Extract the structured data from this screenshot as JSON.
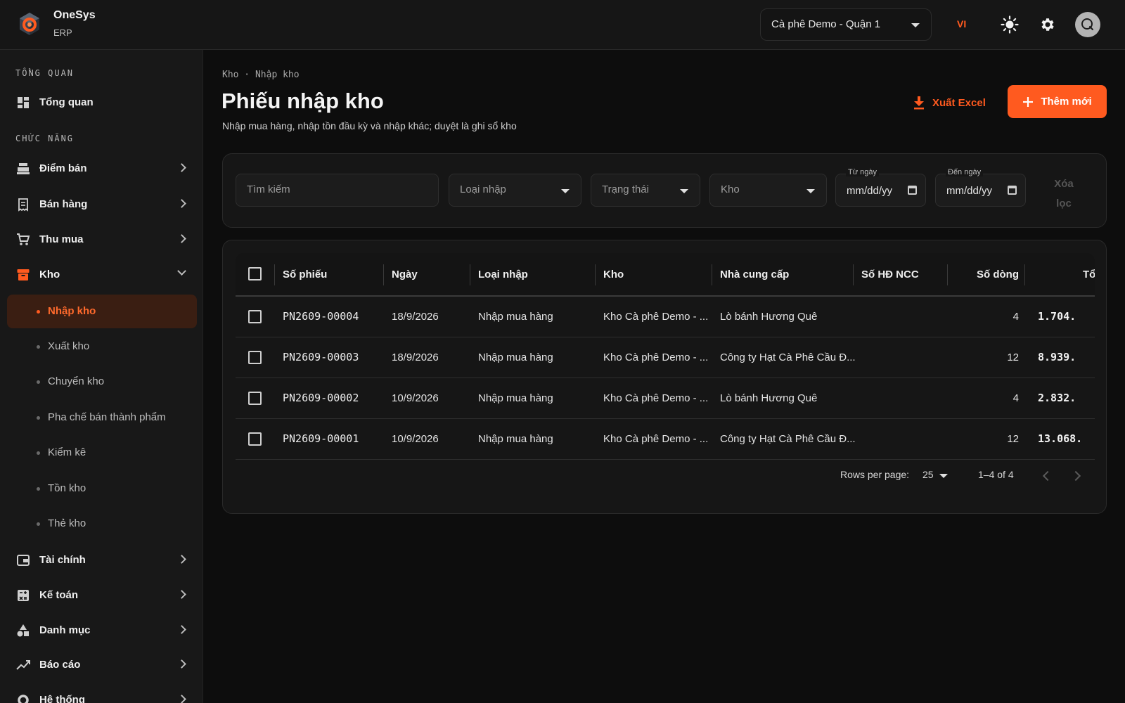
{
  "app": {
    "name": "OneSys",
    "subtitle": "ERP"
  },
  "topbar": {
    "store": "Cà phê Demo - Quận 1",
    "language": "VI"
  },
  "sidebar": {
    "section_overview": "TỔNG QUAN",
    "overview": "Tổng quan",
    "section_functions": "CHỨC NĂNG",
    "items": {
      "pos": "Điểm bán",
      "sales": "Bán hàng",
      "purchasing": "Thu mua",
      "warehouse": "Kho",
      "finance": "Tài chính",
      "accounting": "Kế toán",
      "catalog": "Danh mục",
      "reports": "Báo cáo",
      "system": "Hệ thống"
    },
    "warehouse_sub": {
      "receipt": "Nhập kho",
      "issue": "Xuất kho",
      "transfer": "Chuyển kho",
      "semi_finished": "Pha chế bán thành phẩm",
      "stocktake": "Kiểm kê",
      "inventory": "Tồn kho",
      "stock_card": "Thẻ kho"
    }
  },
  "page": {
    "breadcrumb": "Kho · Nhập kho",
    "title": "Phiếu nhập kho",
    "subtitle": "Nhập mua hàng, nhập tồn đầu kỳ và nhập khác; duyệt là ghi sổ kho",
    "export_label": "Xuất Excel",
    "add_label": "Thêm mới"
  },
  "filters": {
    "search_placeholder": "Tìm kiếm",
    "type_placeholder": "Loại nhập",
    "status_placeholder": "Trạng thái",
    "warehouse_placeholder": "Kho",
    "from_label": "Từ ngày",
    "from_value": "mm/dd/yy",
    "to_label": "Đến ngày",
    "to_value": "mm/dd/yy",
    "clear_label": "Xóa lọc"
  },
  "table": {
    "columns": [
      "Số phiếu",
      "Ngày",
      "Loại nhập",
      "Kho",
      "Nhà cung cấp",
      "Số HĐ NCC",
      "Số dòng",
      "Tổ"
    ],
    "rows": [
      {
        "code": "PN2609-00004",
        "date": "18/9/2026",
        "type": "Nhập mua hàng",
        "warehouse": "Kho Cà phê Demo - ...",
        "supplier": "Lò bánh Hương Quê",
        "invoice": "",
        "lines": "4",
        "total": "1.704."
      },
      {
        "code": "PN2609-00003",
        "date": "18/9/2026",
        "type": "Nhập mua hàng",
        "warehouse": "Kho Cà phê Demo - ...",
        "supplier": "Công ty Hạt Cà Phê Cầu Đ...",
        "invoice": "",
        "lines": "12",
        "total": "8.939."
      },
      {
        "code": "PN2609-00002",
        "date": "10/9/2026",
        "type": "Nhập mua hàng",
        "warehouse": "Kho Cà phê Demo - ...",
        "supplier": "Lò bánh Hương Quê",
        "invoice": "",
        "lines": "4",
        "total": "2.832."
      },
      {
        "code": "PN2609-00001",
        "date": "10/9/2026",
        "type": "Nhập mua hàng",
        "warehouse": "Kho Cà phê Demo - ...",
        "supplier": "Công ty Hạt Cà Phê Cầu Đ...",
        "invoice": "",
        "lines": "12",
        "total": "13.068."
      }
    ]
  },
  "pagination": {
    "rows_per_page_label": "Rows per page:",
    "rows_per_page": "25",
    "range": "1–4 of 4"
  },
  "colors": {
    "accent": "#ff5a1f",
    "background": "#0d0d0d",
    "surface": "#161616"
  }
}
